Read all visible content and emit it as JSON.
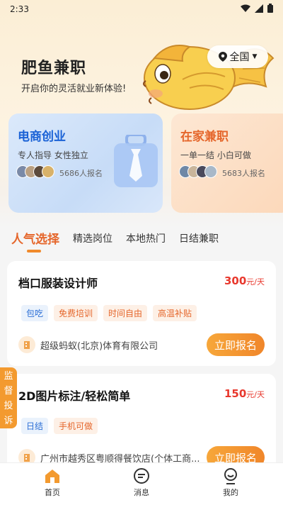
{
  "status_bar": {
    "time": "2:33"
  },
  "header": {
    "title": "肥鱼兼职",
    "subtitle": "开启你的灵活就业新体验!",
    "location": "全国"
  },
  "cards": [
    {
      "title": "电商创业",
      "desc": "专人指导 女性独立",
      "count": "5686人报名"
    },
    {
      "title": "在家兼职",
      "desc": "一单一结 小白可做",
      "count": "5683人报名"
    }
  ],
  "tabs": [
    "人气选择",
    "精选岗位",
    "本地热门",
    "日结兼职"
  ],
  "jobs": [
    {
      "title": "档口服装设计师",
      "salary": "300",
      "unit": "元/天",
      "tags": [
        "包吃",
        "免费培训",
        "时间自由",
        "高温补贴"
      ],
      "company": "超级蚂蚁(北京)体育有限公司",
      "button": "立即报名"
    },
    {
      "title": "2D图片标注/轻松简单",
      "salary": "150",
      "unit": "元/天",
      "tags": [
        "日结",
        "手机可做"
      ],
      "company": "广州市越秀区粤顺得餐饮店(个体工商...",
      "button": "立即报名"
    }
  ],
  "supervise": "监督投诉",
  "nav": [
    "首页",
    "消息",
    "我的"
  ],
  "colors": {
    "accent": "#f08a2c",
    "salary": "#e8382d",
    "blue": "#1a62d6"
  }
}
